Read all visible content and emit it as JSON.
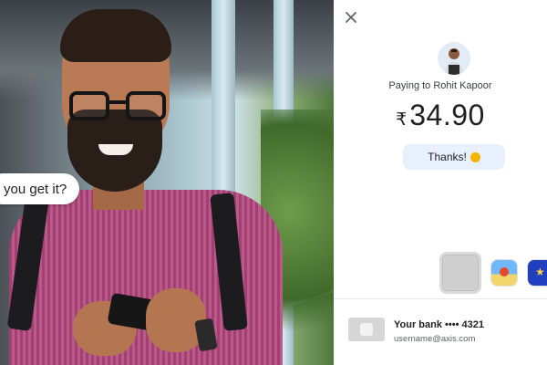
{
  "photo": {
    "chat_bubble_text": "you get it?"
  },
  "payment": {
    "close_icon": "close-icon",
    "paying_label": "Paying to Rohit Kapoor",
    "currency_symbol": "₹",
    "amount": "34.90",
    "note_text": "Thanks!",
    "note_emoji": "smiling-face-icon",
    "stickers": [
      "blank-sticker",
      "beach-sticker",
      "night-sky-sticker"
    ],
    "bank": {
      "name": "Your bank •••• 4321",
      "upi_id": "username@axis.com"
    }
  },
  "colors": {
    "note_bg": "#e8f0fe",
    "accent_text": "#202124",
    "shirt": "#a53f73"
  }
}
